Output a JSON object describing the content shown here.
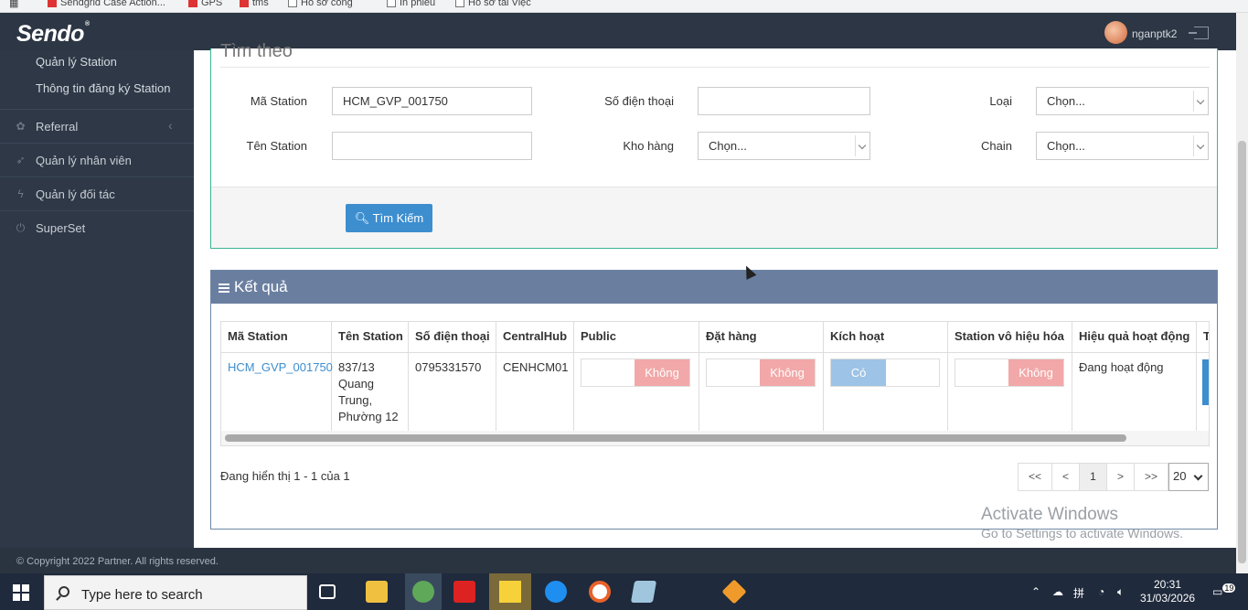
{
  "bookmarks": [
    "Sendgrid Case Action...",
    "GPS",
    "tms",
    "Hồ sơ công",
    "In phiếu",
    "Hỗ sơ tài Việc"
  ],
  "header": {
    "logo": "Sendo",
    "logo_mark": "®",
    "username": "nganptk2"
  },
  "sidebar": {
    "sub_items": [
      "Quản lý Station",
      "Thông tin đăng ký Station"
    ],
    "items": [
      {
        "label": "Referral",
        "icon": "gift-icon",
        "chevron": "‹"
      },
      {
        "label": "Quản lý nhân viên",
        "icon": "rocket-icon"
      },
      {
        "label": "Quản lý đối tác",
        "icon": "bolt-icon"
      },
      {
        "label": "SuperSet",
        "icon": "power-icon"
      }
    ]
  },
  "search": {
    "title": "Tìm theo",
    "ma_station_label": "Mã Station",
    "ma_station_value": "HCM_GVP_001750",
    "phone_label": "Số điện thoại",
    "phone_value": "",
    "loai_label": "Loại",
    "loai_value": "Chọn...",
    "ten_station_label": "Tên Station",
    "ten_station_value": "",
    "kho_label": "Kho hàng",
    "kho_value": "Chọn...",
    "chain_label": "Chain",
    "chain_value": "Chọn...",
    "button_label": "Tìm Kiếm"
  },
  "results": {
    "title": "Kết quả",
    "columns": [
      "Mã Station",
      "Tên Station",
      "Số điện thoại",
      "CentralHub",
      "Public",
      "Đặt hàng",
      "Kích hoạt",
      "Station vô hiệu hóa",
      "Hiệu quả hoạt động",
      "T"
    ],
    "row": {
      "ma_station": "HCM_GVP_001750",
      "ten_station": [
        "837/13",
        "Quang",
        "Trung,",
        "Phường 12"
      ],
      "phone": "0795331570",
      "central_hub": "CENHCM01",
      "public": "Không",
      "dat_hang": "Không",
      "kich_hoat": "Có",
      "vo_hieu_hoa": "Không",
      "hieu_qua": "Đang hoạt động"
    },
    "showing": "Đang hiển thị 1 - 1 của 1",
    "pager": [
      "<<",
      "<",
      "1",
      ">",
      ">>"
    ],
    "page_size": "20"
  },
  "footer": {
    "copyright": "© Copyright 2022 Partner. All rights reserved."
  },
  "watermark": {
    "line1": "Activate Windows",
    "line2": "Go to Settings to activate Windows."
  },
  "taskbar": {
    "search_placeholder": "Type here to search",
    "ime": "拼",
    "time": "20:31",
    "date": "31/03/2026",
    "notifications": "19"
  }
}
